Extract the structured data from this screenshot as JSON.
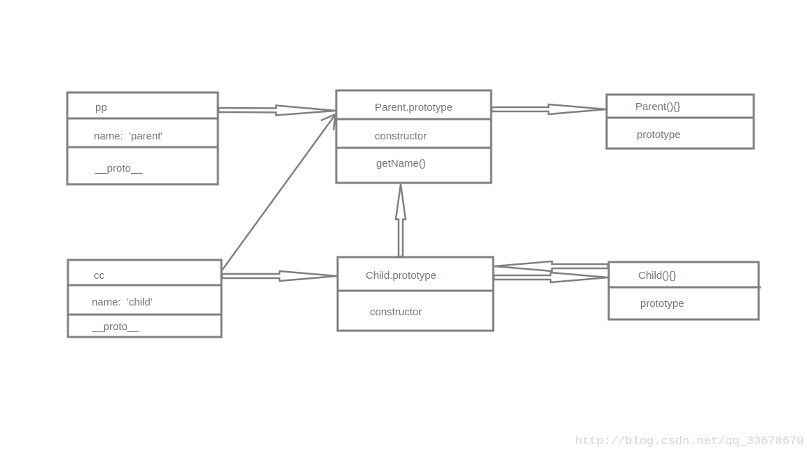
{
  "boxes": {
    "pp": {
      "title": "pp",
      "rows": [
        "name:  'parent'",
        "__proto__"
      ]
    },
    "parent_prototype": {
      "title": "Parent.prototype",
      "rows": [
        "constructor",
        "getName()"
      ]
    },
    "parent_fn": {
      "title": "Parent(){}",
      "rows": [
        "prototype"
      ]
    },
    "cc": {
      "title": "cc",
      "rows": [
        "name:  'child'",
        "__proto__"
      ]
    },
    "child_prototype": {
      "title": "Child.prototype",
      "rows": [
        "constructor"
      ]
    },
    "child_fn": {
      "title": "Child(){}",
      "rows": [
        "prototype"
      ]
    }
  },
  "edges": [
    {
      "from": "pp",
      "to": "parent_prototype"
    },
    {
      "from": "parent_prototype",
      "to": "parent_fn"
    },
    {
      "from": "cc",
      "to": "parent_prototype"
    },
    {
      "from": "cc",
      "to": "child_prototype"
    },
    {
      "from": "child_prototype",
      "to": "parent_prototype"
    },
    {
      "from": "child_prototype",
      "to": "child_fn"
    },
    {
      "from": "child_fn",
      "to": "child_prototype"
    }
  ],
  "watermark": "http://blog.csdn.net/qq_33678670",
  "colors": {
    "stroke": "#808080",
    "text": "#6f7580",
    "watermark": "#d4d4d4"
  }
}
